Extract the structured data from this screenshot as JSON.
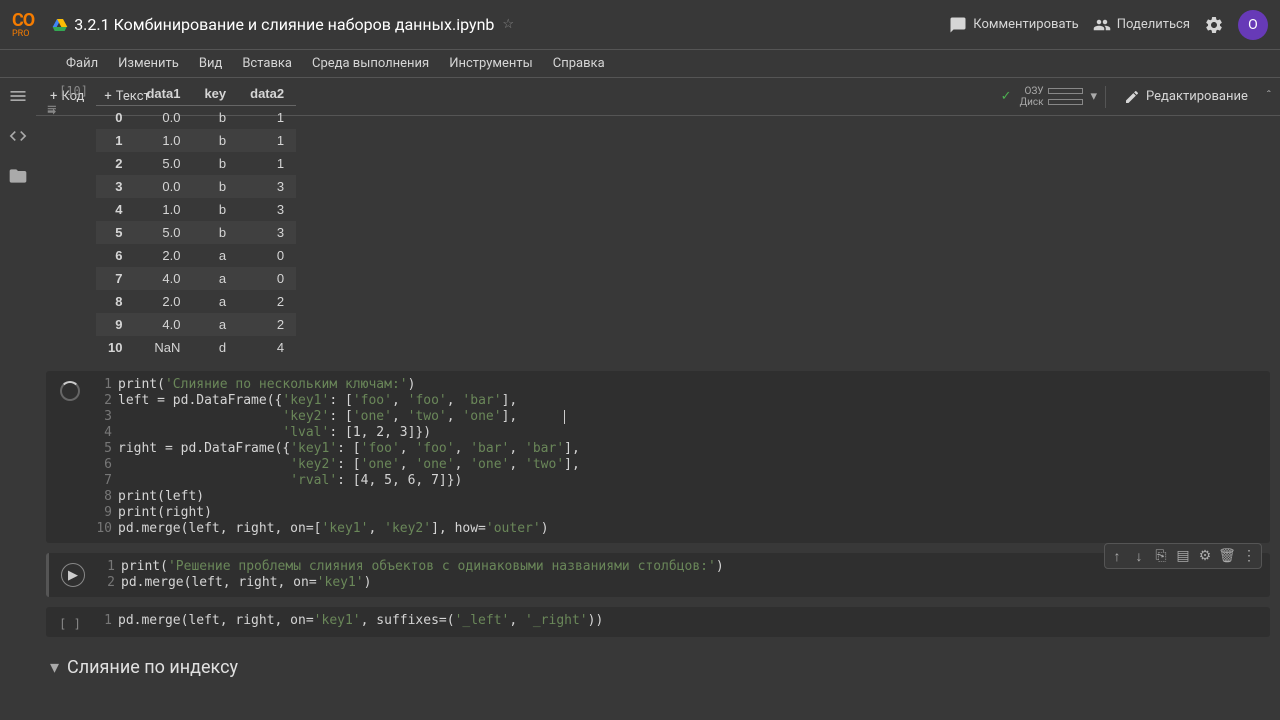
{
  "header": {
    "logo": "CO",
    "logo_sub": "PRO",
    "title": "3.2.1 Комбинирование и слияние наборов данных.ipynb",
    "comment": "Комментировать",
    "share": "Поделиться",
    "avatar": "O"
  },
  "menu": {
    "file": "Файл",
    "edit": "Изменить",
    "view": "Вид",
    "insert": "Вставка",
    "runtime": "Среда выполнения",
    "tools": "Инструменты",
    "help": "Справка"
  },
  "toolbar": {
    "code": "Код",
    "text": "Текст",
    "ram": "ОЗУ",
    "disk": "Диск",
    "editing": "Редактирование"
  },
  "output": {
    "prompt": "[10]",
    "headers": [
      "",
      "data1",
      "key",
      "data2"
    ],
    "rows": [
      [
        "0",
        "0.0",
        "b",
        "1"
      ],
      [
        "1",
        "1.0",
        "b",
        "1"
      ],
      [
        "2",
        "5.0",
        "b",
        "1"
      ],
      [
        "3",
        "0.0",
        "b",
        "3"
      ],
      [
        "4",
        "1.0",
        "b",
        "3"
      ],
      [
        "5",
        "5.0",
        "b",
        "3"
      ],
      [
        "6",
        "2.0",
        "a",
        "0"
      ],
      [
        "7",
        "4.0",
        "a",
        "0"
      ],
      [
        "8",
        "2.0",
        "a",
        "2"
      ],
      [
        "9",
        "4.0",
        "a",
        "2"
      ],
      [
        "10",
        "NaN",
        "d",
        "4"
      ]
    ]
  },
  "cell1": {
    "l1a": "print(",
    "l1b": "'Слияние по нескольким ключам:'",
    "l1c": ")",
    "l2a": "left = pd.DataFrame({",
    "l2b": "'key1'",
    "l2c": ": [",
    "l2d": "'foo'",
    "l2e": ", ",
    "l2f": "'foo'",
    "l2g": ", ",
    "l2h": "'bar'",
    "l2i": "],",
    "l3a": "                     ",
    "l3b": "'key2'",
    "l3c": ": [",
    "l3d": "'one'",
    "l3e": ", ",
    "l3f": "'two'",
    "l3g": ", ",
    "l3h": "'one'",
    "l3i": "],",
    "l4a": "                     ",
    "l4b": "'lval'",
    "l4c": ": [1, 2, 3]})",
    "l5a": "right = pd.DataFrame({",
    "l5b": "'key1'",
    "l5c": ": [",
    "l5d": "'foo'",
    "l5e": ", ",
    "l5f": "'foo'",
    "l5g": ", ",
    "l5h": "'bar'",
    "l5i": ", ",
    "l5j": "'bar'",
    "l5k": "],",
    "l6a": "                      ",
    "l6b": "'key2'",
    "l6c": ": [",
    "l6d": "'one'",
    "l6e": ", ",
    "l6f": "'one'",
    "l6g": ", ",
    "l6h": "'one'",
    "l6i": ", ",
    "l6j": "'two'",
    "l6k": "],",
    "l7a": "                      ",
    "l7b": "'rval'",
    "l7c": ": [4, 5, 6, 7]})",
    "l8": "print(left)",
    "l9": "print(right)",
    "l10a": "pd.merge(left, right, on=[",
    "l10b": "'key1'",
    "l10c": ", ",
    "l10d": "'key2'",
    "l10e": "], how=",
    "l10f": "'outer'",
    "l10g": ")"
  },
  "cell2": {
    "l1a": "print(",
    "l1b": "'Решение проблемы слияния объектов с одинаковыми названиями столбцов:'",
    "l1c": ")",
    "l2a": "pd.merge(left, right, on=",
    "l2b": "'key1'",
    "l2c": ")"
  },
  "cell3": {
    "prompt": "[ ]",
    "l1a": "pd.merge(left, right, on=",
    "l1b": "'key1'",
    "l1c": ", suffixes=(",
    "l1d": "'_left'",
    "l1e": ", ",
    "l1f": "'_right'",
    "l1g": "))"
  },
  "section": {
    "title": "Слияние по индексу"
  }
}
